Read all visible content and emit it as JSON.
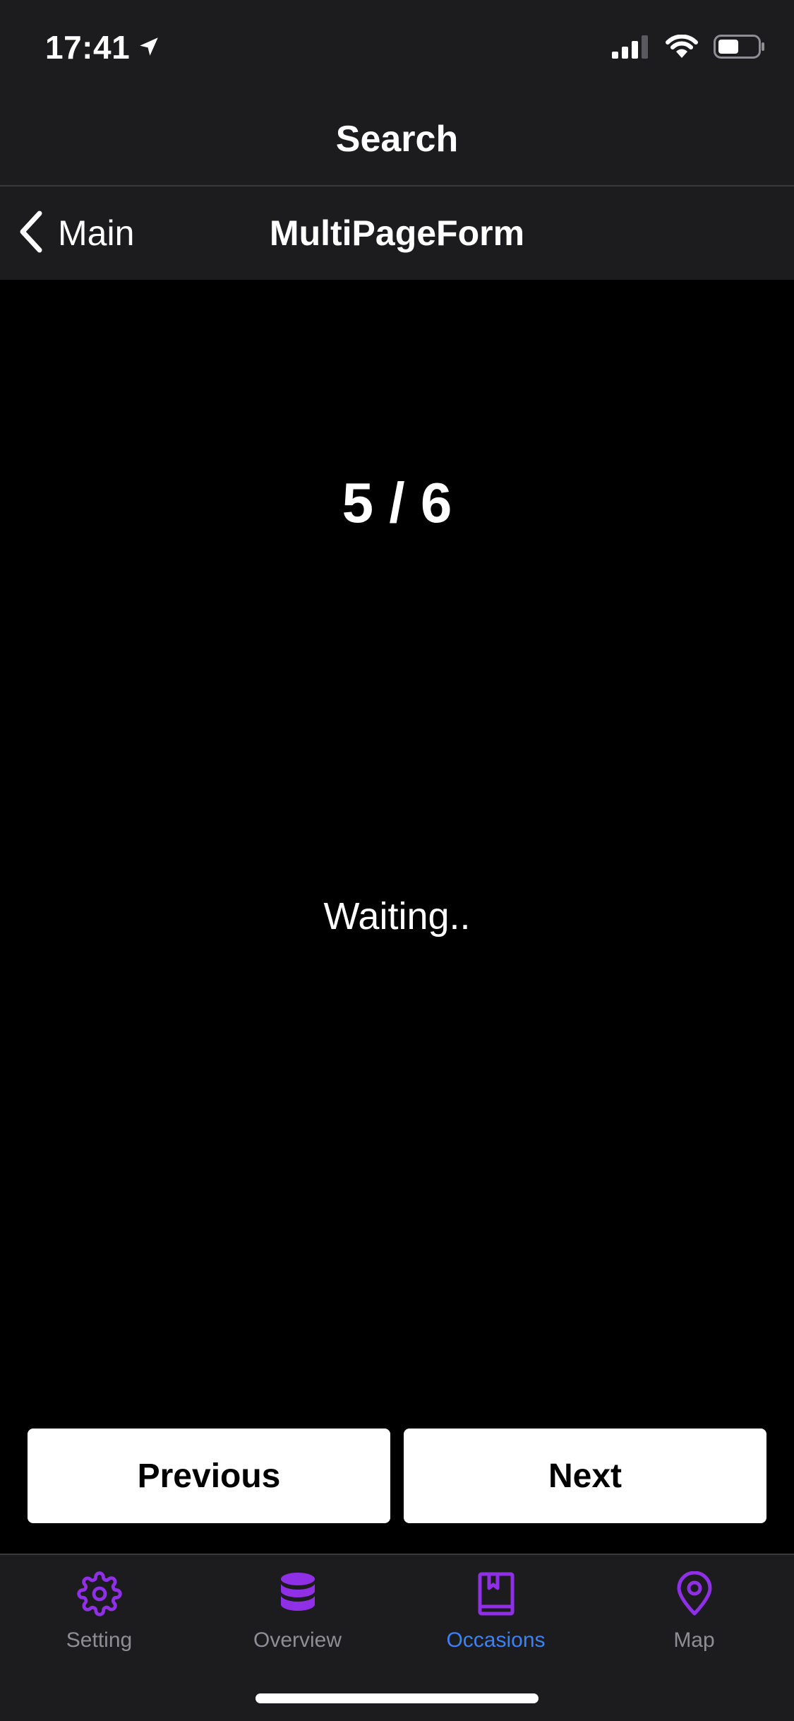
{
  "status_bar": {
    "time": "17:41",
    "icons": [
      "location-arrow-icon",
      "cellular-signal-icon",
      "wifi-icon",
      "battery-icon"
    ]
  },
  "title_bar": {
    "title": "Search"
  },
  "nav_bar": {
    "back_label": "Main",
    "title": "MultiPageForm"
  },
  "content": {
    "page_counter": "5 / 6",
    "status_text": "Waiting.."
  },
  "buttons": {
    "previous_label": "Previous",
    "next_label": "Next"
  },
  "tab_bar": {
    "accent_color": "#8f2fe6",
    "active_label_color": "#3c82f6",
    "items": [
      {
        "label": "Setting",
        "icon": "gear-icon",
        "active": false
      },
      {
        "label": "Overview",
        "icon": "database-icon",
        "active": false
      },
      {
        "label": "Occasions",
        "icon": "book-icon",
        "active": true
      },
      {
        "label": "Map",
        "icon": "map-pin-icon",
        "active": false
      }
    ]
  }
}
